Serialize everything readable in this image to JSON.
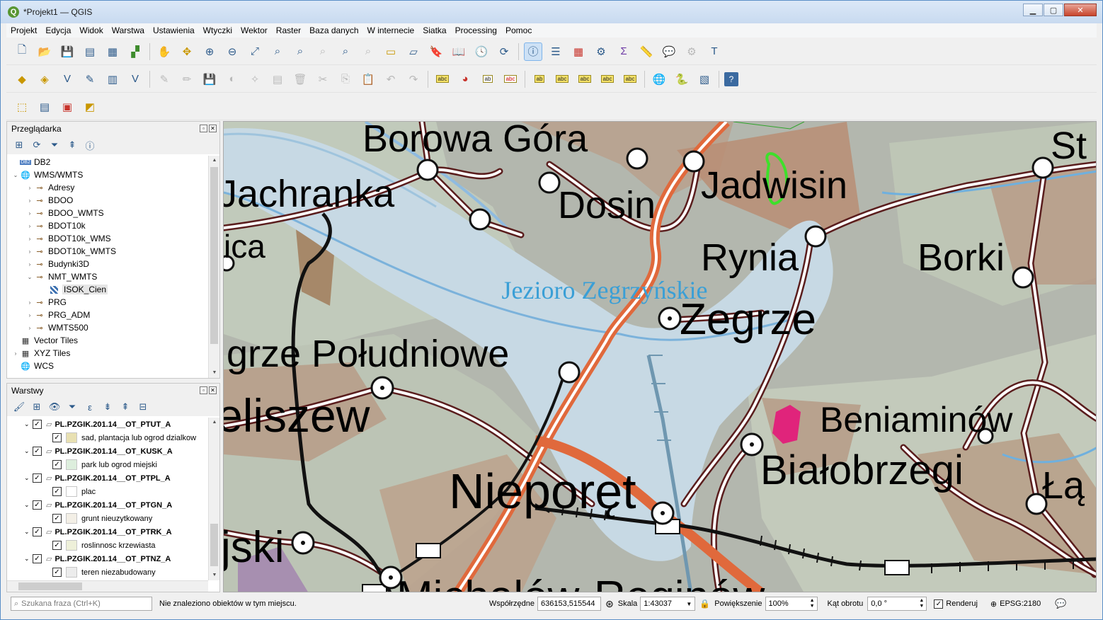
{
  "window": {
    "title": "*Projekt1 — QGIS",
    "logo": "Q"
  },
  "menu": [
    "Projekt",
    "Edycja",
    "Widok",
    "Warstwa",
    "Ustawienia",
    "Wtyczki",
    "Wektor",
    "Raster",
    "Baza danych",
    "W internecie",
    "Siatka",
    "Processing",
    "Pomoc"
  ],
  "browser": {
    "title": "Przeglądarka",
    "items": [
      {
        "label": "DB2",
        "level": 0,
        "arrow": "",
        "icon": "db2-icon"
      },
      {
        "label": "WMS/WMTS",
        "level": 0,
        "arrow": "▼",
        "icon": "globe-icon"
      },
      {
        "label": "Adresy",
        "level": 1,
        "arrow": "▶",
        "icon": "wms-connection-icon"
      },
      {
        "label": "BDOO",
        "level": 1,
        "arrow": "▶",
        "icon": "wms-connection-icon"
      },
      {
        "label": "BDOO_WMTS",
        "level": 1,
        "arrow": "▶",
        "icon": "wms-connection-icon"
      },
      {
        "label": "BDOT10k",
        "level": 1,
        "arrow": "▶",
        "icon": "wms-connection-icon"
      },
      {
        "label": "BDOT10k_WMS",
        "level": 1,
        "arrow": "▶",
        "icon": "wms-connection-icon"
      },
      {
        "label": "BDOT10k_WMTS",
        "level": 1,
        "arrow": "▶",
        "icon": "wms-connection-icon"
      },
      {
        "label": "Budynki3D",
        "level": 1,
        "arrow": "▶",
        "icon": "wms-connection-icon"
      },
      {
        "label": "NMT_WMTS",
        "level": 1,
        "arrow": "▼",
        "icon": "wms-connection-icon"
      },
      {
        "label": "ISOK_Cien",
        "level": 2,
        "arrow": "",
        "icon": "raster-layer-icon",
        "selected": true
      },
      {
        "label": "PRG",
        "level": 1,
        "arrow": "▶",
        "icon": "wms-connection-icon"
      },
      {
        "label": "PRG_ADM",
        "level": 1,
        "arrow": "▶",
        "icon": "wms-connection-icon"
      },
      {
        "label": "WMTS500",
        "level": 1,
        "arrow": "▶",
        "icon": "wms-connection-icon"
      },
      {
        "label": "Vector Tiles",
        "level": 0,
        "arrow": "",
        "icon": "grid-icon"
      },
      {
        "label": "XYZ Tiles",
        "level": 0,
        "arrow": "▶",
        "icon": "grid-icon"
      },
      {
        "label": "WCS",
        "level": 0,
        "arrow": "",
        "icon": "globe-icon"
      }
    ]
  },
  "layers": {
    "title": "Warstwy",
    "items": [
      {
        "kind": "group",
        "label": "PL.PZGIK.201.14__OT_PTUT_A"
      },
      {
        "kind": "class",
        "label": "sad, plantacja lub ogrod dzialkow",
        "color": "#e8e0b2"
      },
      {
        "kind": "group",
        "label": "PL.PZGIK.201.14__OT_KUSK_A"
      },
      {
        "kind": "class",
        "label": "park lub ogrod miejski",
        "color": "#ddeedd"
      },
      {
        "kind": "group",
        "label": "PL.PZGIK.201.14__OT_PTPL_A"
      },
      {
        "kind": "class",
        "label": "plac",
        "color": "#ffffff"
      },
      {
        "kind": "group",
        "label": "PL.PZGIK.201.14__OT_PTGN_A"
      },
      {
        "kind": "class",
        "label": "grunt nieuzytkowany",
        "color": "#f3efe6"
      },
      {
        "kind": "group",
        "label": "PL.PZGIK.201.14__OT_PTRK_A"
      },
      {
        "kind": "class",
        "label": "roslinnosc krzewiasta",
        "color": "#eef0d9"
      },
      {
        "kind": "group",
        "label": "PL.PZGIK.201.14__OT_PTNZ_A"
      },
      {
        "kind": "class",
        "label": "teren niezabudowany",
        "color": "#ececec"
      }
    ]
  },
  "map": {
    "lake_label": "Jezioro Zegrzyńskie",
    "places": [
      "Borowa Góra",
      "Jachranka",
      "Dosin",
      "Jadwisin",
      "St",
      "ica",
      "Rynia",
      "Borki",
      "Zegrze",
      "grze Południowe",
      "eliszew",
      "Beniaminów",
      "Białobrzegi",
      "Nieporęt",
      "Łą",
      "jski",
      "Michałów-Reginów"
    ]
  },
  "status": {
    "search_placeholder": "Szukana fraza (Ctrl+K)",
    "message": "Nie znaleziono obiektów w tym miejscu.",
    "coords_label": "Współrzędne",
    "coords": "636153,515544",
    "scale_label": "Skala",
    "scale": "1:43037",
    "zoom_label": "Powiększenie",
    "zoom": "100%",
    "rotation_label": "Kąt obrotu",
    "rotation": "0,0 °",
    "render_label": "Renderuj",
    "crs": "EPSG:2180"
  },
  "colors": {
    "accent": "#3a8fd8",
    "lake": "#c7d9e4",
    "road": "#5a1d1d",
    "main_road": "#e0693c"
  }
}
